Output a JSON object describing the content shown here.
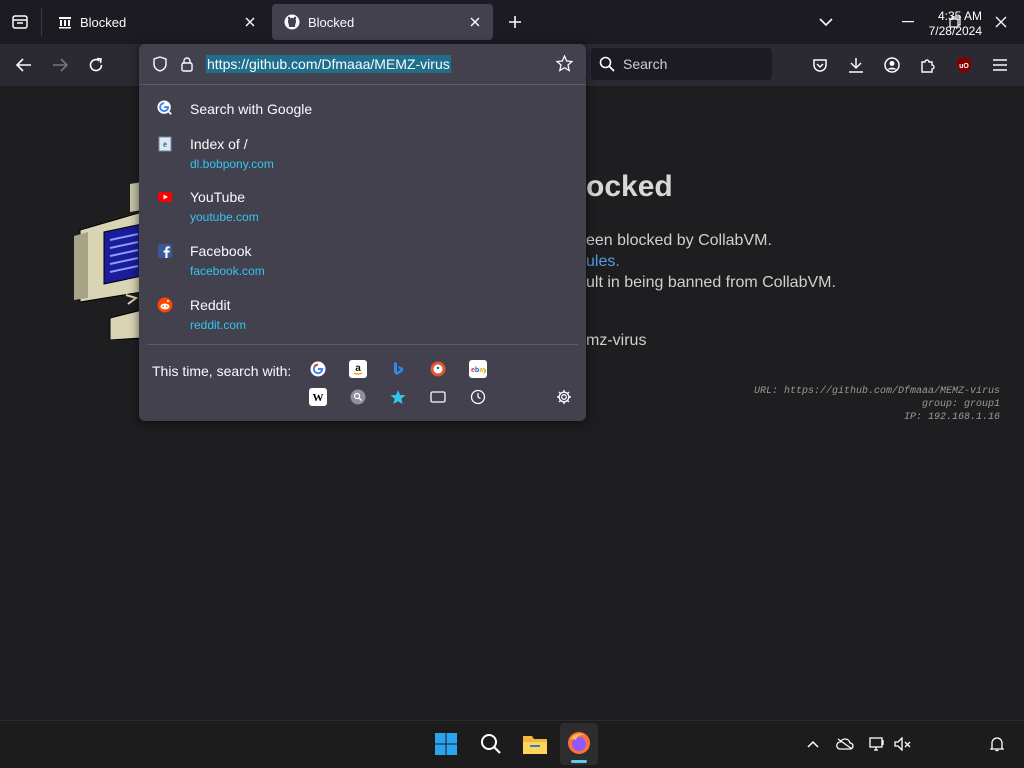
{
  "tabs": [
    {
      "title": "Blocked",
      "icon": "bank-icon"
    },
    {
      "title": "Blocked",
      "icon": "github-icon"
    }
  ],
  "toolbar": {
    "search_placeholder": "Search"
  },
  "urlbar": {
    "url": "https://github.com/Dfmaaa/MEMZ-virus"
  },
  "suggestions": [
    {
      "title": "Search with Google",
      "url": "",
      "icon": "google-search-icon"
    },
    {
      "title": "Index of /",
      "url": "dl.bobpony.com",
      "icon": "ie-page-icon"
    },
    {
      "title": "YouTube",
      "url": "youtube.com",
      "icon": "youtube-icon"
    },
    {
      "title": "Facebook",
      "url": "facebook.com",
      "icon": "facebook-icon"
    },
    {
      "title": "Reddit",
      "url": "reddit.com",
      "icon": "reddit-icon"
    }
  ],
  "search_with": {
    "label": "This time, search with:",
    "engines": [
      "google",
      "amazon",
      "bing",
      "duckduckgo",
      "ebay",
      "wikipedia",
      "search-history",
      "bookmarks",
      "tabs",
      "history"
    ]
  },
  "page": {
    "heading_fragment": "ocked",
    "line1": "een blocked by CollabVM.",
    "line2": "ules.",
    "line3": "ult in being banned from CollabVM.",
    "line4": "mz-virus",
    "meta_url": "URL: https://github.com/Dfmaaa/MEMZ-virus",
    "meta_group": "group: group1",
    "meta_ip": "IP: 192.168.1.16"
  },
  "taskbar": {
    "time": "4:35 AM",
    "date": "7/28/2024"
  },
  "colors": {
    "accent": "#33c6f0",
    "link": "#5a9bea",
    "selection": "#1f6e8c"
  }
}
